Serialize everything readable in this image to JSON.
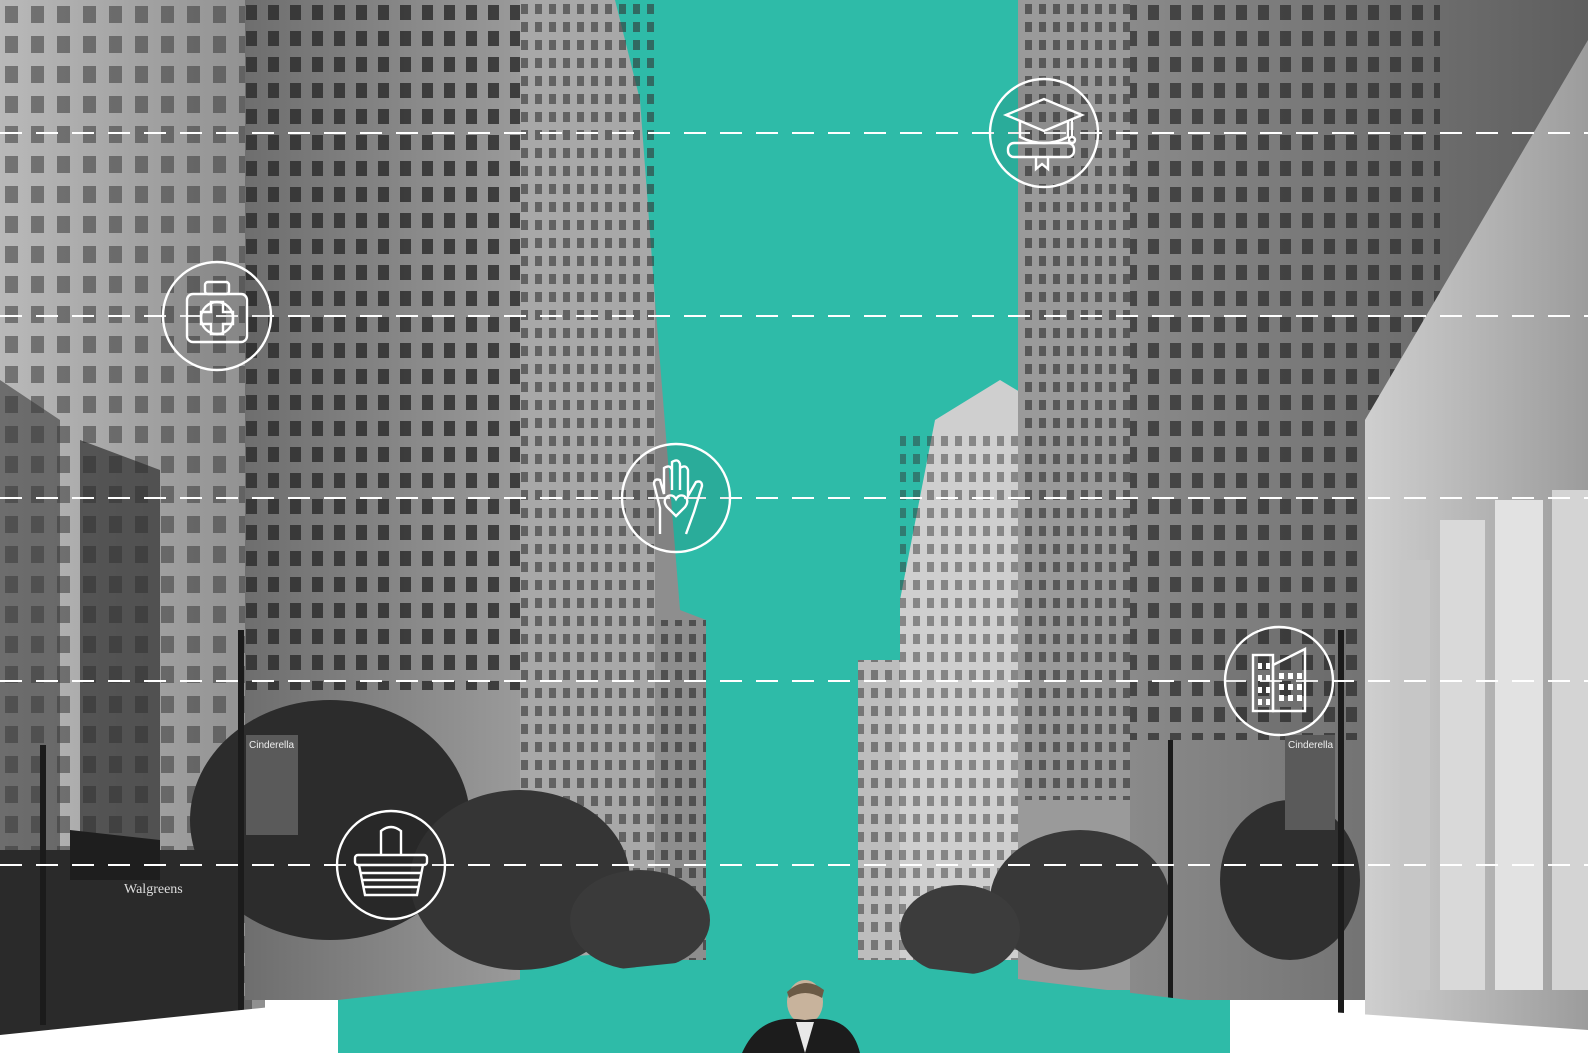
{
  "colors": {
    "teal": "#2ebba8",
    "background": "#ffffff",
    "dash": "#ffffff",
    "building_dark": "#4a4a4a",
    "building_mid": "#7d7d7d",
    "building_light": "#b5b5b5"
  },
  "icons": [
    {
      "name": "graduation-cap-icon"
    },
    {
      "name": "first-aid-kit-icon"
    },
    {
      "name": "helping-hand-heart-icon"
    },
    {
      "name": "office-building-icon"
    },
    {
      "name": "shopping-basket-icon"
    }
  ],
  "signage": {
    "storefront": "Walgreens",
    "banner_left": "Cinderella",
    "banner_right": "Cinderella"
  }
}
